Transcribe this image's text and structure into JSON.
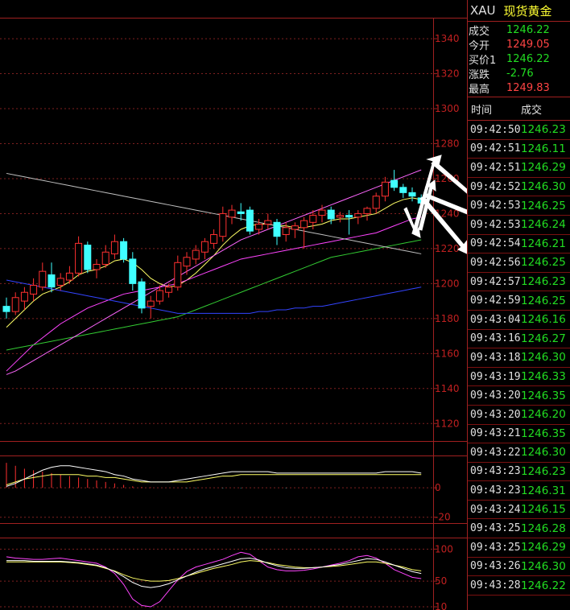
{
  "quote": {
    "symbol": "XAU",
    "name": "现货黄金",
    "fields": [
      {
        "label": "成交",
        "value": "1246.22",
        "color": "#22dd22"
      },
      {
        "label": "今开",
        "value": "1249.05",
        "color": "#ff4444"
      },
      {
        "label": "买价1",
        "value": "1246.22",
        "color": "#22dd22"
      },
      {
        "label": "涨跌",
        "value": "-2.76",
        "color": "#22dd22"
      },
      {
        "label": "最高",
        "value": "1249.83",
        "color": "#ff4444"
      }
    ],
    "ticks_header": {
      "time": "时间",
      "price": "成交"
    },
    "ticks": [
      {
        "time": "09:42:50",
        "price": "1246.23"
      },
      {
        "time": "09:42:51",
        "price": "1246.11"
      },
      {
        "time": "09:42:51",
        "price": "1246.29"
      },
      {
        "time": "09:42:52",
        "price": "1246.30"
      },
      {
        "time": "09:42:53",
        "price": "1246.25"
      },
      {
        "time": "09:42:53",
        "price": "1246.24"
      },
      {
        "time": "09:42:54",
        "price": "1246.21"
      },
      {
        "time": "09:42:56",
        "price": "1246.25"
      },
      {
        "time": "09:42:57",
        "price": "1246.23"
      },
      {
        "time": "09:42:59",
        "price": "1246.25"
      },
      {
        "time": "09:43:04",
        "price": "1246.16"
      },
      {
        "time": "09:43:16",
        "price": "1246.27"
      },
      {
        "time": "09:43:18",
        "price": "1246.30"
      },
      {
        "time": "09:43:19",
        "price": "1246.33"
      },
      {
        "time": "09:43:20",
        "price": "1246.35"
      },
      {
        "time": "09:43:20",
        "price": "1246.20"
      },
      {
        "time": "09:43:21",
        "price": "1246.35"
      },
      {
        "time": "09:43:22",
        "price": "1246.30"
      },
      {
        "time": "09:43:23",
        "price": "1246.23"
      },
      {
        "time": "09:43:23",
        "price": "1246.31"
      },
      {
        "time": "09:43:24",
        "price": "1246.15"
      },
      {
        "time": "09:43:25",
        "price": "1246.28"
      },
      {
        "time": "09:43:25",
        "price": "1246.29"
      },
      {
        "time": "09:43:26",
        "price": "1246.30"
      },
      {
        "time": "09:43:28",
        "price": "1246.22"
      }
    ]
  },
  "chart_data": [
    {
      "type": "candlestick",
      "y_ticks": [
        1120,
        1140,
        1160,
        1180,
        1200,
        1220,
        1240,
        1260,
        1280,
        1300,
        1320,
        1340
      ],
      "ylim": [
        1110,
        1352
      ],
      "up_color": "#ff3030",
      "down_color": "#40ffff",
      "candles": [
        {
          "o": 1187,
          "h": 1192,
          "l": 1180,
          "c": 1184
        },
        {
          "o": 1184,
          "h": 1195,
          "l": 1182,
          "c": 1192
        },
        {
          "o": 1190,
          "h": 1198,
          "l": 1185,
          "c": 1195
        },
        {
          "o": 1194,
          "h": 1203,
          "l": 1190,
          "c": 1199
        },
        {
          "o": 1198,
          "h": 1212,
          "l": 1196,
          "c": 1207
        },
        {
          "o": 1205,
          "h": 1212,
          "l": 1195,
          "c": 1198
        },
        {
          "o": 1199,
          "h": 1206,
          "l": 1196,
          "c": 1203
        },
        {
          "o": 1202,
          "h": 1210,
          "l": 1200,
          "c": 1206
        },
        {
          "o": 1206,
          "h": 1227,
          "l": 1204,
          "c": 1223
        },
        {
          "o": 1222,
          "h": 1224,
          "l": 1206,
          "c": 1208
        },
        {
          "o": 1208,
          "h": 1214,
          "l": 1203,
          "c": 1211
        },
        {
          "o": 1211,
          "h": 1222,
          "l": 1209,
          "c": 1218
        },
        {
          "o": 1217,
          "h": 1228,
          "l": 1214,
          "c": 1224
        },
        {
          "o": 1224,
          "h": 1226,
          "l": 1212,
          "c": 1214
        },
        {
          "o": 1214,
          "h": 1218,
          "l": 1196,
          "c": 1200
        },
        {
          "o": 1201,
          "h": 1203,
          "l": 1183,
          "c": 1186
        },
        {
          "o": 1187,
          "h": 1193,
          "l": 1180,
          "c": 1190
        },
        {
          "o": 1190,
          "h": 1199,
          "l": 1188,
          "c": 1196
        },
        {
          "o": 1195,
          "h": 1200,
          "l": 1192,
          "c": 1198
        },
        {
          "o": 1198,
          "h": 1216,
          "l": 1196,
          "c": 1212
        },
        {
          "o": 1210,
          "h": 1218,
          "l": 1205,
          "c": 1215
        },
        {
          "o": 1214,
          "h": 1222,
          "l": 1211,
          "c": 1219
        },
        {
          "o": 1218,
          "h": 1226,
          "l": 1214,
          "c": 1224
        },
        {
          "o": 1223,
          "h": 1231,
          "l": 1220,
          "c": 1228
        },
        {
          "o": 1227,
          "h": 1244,
          "l": 1224,
          "c": 1240
        },
        {
          "o": 1238,
          "h": 1245,
          "l": 1234,
          "c": 1242
        },
        {
          "o": 1241,
          "h": 1246,
          "l": 1236,
          "c": 1240
        },
        {
          "o": 1242,
          "h": 1244,
          "l": 1228,
          "c": 1230
        },
        {
          "o": 1231,
          "h": 1237,
          "l": 1228,
          "c": 1234
        },
        {
          "o": 1234,
          "h": 1240,
          "l": 1231,
          "c": 1236
        },
        {
          "o": 1235,
          "h": 1237,
          "l": 1222,
          "c": 1227
        },
        {
          "o": 1228,
          "h": 1235,
          "l": 1224,
          "c": 1232
        },
        {
          "o": 1231,
          "h": 1235,
          "l": 1226,
          "c": 1233
        },
        {
          "o": 1232,
          "h": 1238,
          "l": 1220,
          "c": 1236
        },
        {
          "o": 1235,
          "h": 1242,
          "l": 1231,
          "c": 1239
        },
        {
          "o": 1239,
          "h": 1245,
          "l": 1235,
          "c": 1242
        },
        {
          "o": 1242,
          "h": 1244,
          "l": 1234,
          "c": 1237
        },
        {
          "o": 1238,
          "h": 1241,
          "l": 1235,
          "c": 1239
        },
        {
          "o": 1239,
          "h": 1242,
          "l": 1228,
          "c": 1238
        },
        {
          "o": 1238,
          "h": 1242,
          "l": 1234,
          "c": 1240
        },
        {
          "o": 1240,
          "h": 1244,
          "l": 1236,
          "c": 1243
        },
        {
          "o": 1243,
          "h": 1252,
          "l": 1240,
          "c": 1250
        },
        {
          "o": 1250,
          "h": 1261,
          "l": 1247,
          "c": 1258
        },
        {
          "o": 1259,
          "h": 1265,
          "l": 1253,
          "c": 1255
        },
        {
          "o": 1255,
          "h": 1257,
          "l": 1249,
          "c": 1252
        },
        {
          "o": 1252,
          "h": 1255,
          "l": 1247,
          "c": 1250
        },
        {
          "o": 1249,
          "h": 1251,
          "l": 1240,
          "c": 1246
        }
      ],
      "ma_lines": [
        {
          "color": "#ffff66",
          "values": [
            1175,
            1180,
            1185,
            1190,
            1194,
            1196,
            1198,
            1201,
            1205,
            1207,
            1208,
            1210,
            1213,
            1214,
            1212,
            1208,
            1203,
            1200,
            1198,
            1199,
            1202,
            1206,
            1211,
            1216,
            1222,
            1227,
            1231,
            1233,
            1234,
            1234,
            1233,
            1233,
            1232,
            1232,
            1233,
            1234,
            1236,
            1237,
            1237,
            1238,
            1239,
            1240,
            1243,
            1246,
            1248,
            1249,
            1248
          ]
        },
        {
          "color": "#ff44ff",
          "values": [
            1150,
            1155,
            1160,
            1165,
            1169,
            1173,
            1177,
            1180,
            1183,
            1186,
            1188,
            1190,
            1192,
            1194,
            1195,
            1196,
            1197,
            1198,
            1199,
            1200,
            1202,
            1204,
            1206,
            1208,
            1210,
            1212,
            1214,
            1215,
            1216,
            1217,
            1218,
            1219,
            1220,
            1221,
            1222,
            1223,
            1224,
            1225,
            1226,
            1227,
            1228,
            1229,
            1231,
            1233,
            1235,
            1237,
            1238
          ]
        },
        {
          "color": "#33cc33",
          "values": [
            1162,
            1163,
            1164,
            1165,
            1166,
            1167,
            1168,
            1169,
            1170,
            1171,
            1172,
            1173,
            1174,
            1175,
            1176,
            1177,
            1178,
            1179,
            1180,
            1181,
            1183,
            1185,
            1187,
            1189,
            1191,
            1193,
            1195,
            1197,
            1199,
            1201,
            1203,
            1205,
            1207,
            1209,
            1211,
            1213,
            1215,
            1216,
            1217,
            1218,
            1219,
            1220,
            1221,
            1222,
            1223,
            1224,
            1225
          ]
        },
        {
          "color": "#c0c0c0",
          "values": [
            1263,
            1262,
            1261,
            1260,
            1259,
            1258,
            1257,
            1256,
            1255,
            1254,
            1253,
            1252,
            1251,
            1250,
            1249,
            1248,
            1247,
            1246,
            1245,
            1244,
            1243,
            1242,
            1241,
            1240,
            1239,
            1238,
            1237,
            1236,
            1235,
            1234,
            1233,
            1232,
            1231,
            1230,
            1229,
            1228,
            1227,
            1226,
            1225,
            1224,
            1223,
            1222,
            1221,
            1220,
            1219,
            1218,
            1217
          ]
        },
        {
          "color": "#3344ff",
          "values": [
            1202,
            1201,
            1200,
            1199,
            1198,
            1197,
            1196,
            1195,
            1194,
            1193,
            1192,
            1191,
            1190,
            1189,
            1188,
            1187,
            1186,
            1185,
            1184,
            1183,
            1183,
            1183,
            1183,
            1183,
            1183,
            1183,
            1183,
            1183,
            1184,
            1184,
            1185,
            1185,
            1186,
            1186,
            1187,
            1187,
            1188,
            1189,
            1190,
            1191,
            1192,
            1193,
            1194,
            1195,
            1196,
            1197,
            1198
          ]
        },
        {
          "color": "#ff66ff",
          "values": [
            1148,
            1150,
            1153,
            1156,
            1159,
            1162,
            1165,
            1168,
            1171,
            1174,
            1177,
            1180,
            1183,
            1186,
            1189,
            1192,
            1195,
            1198,
            1201,
            1204,
            1207,
            1210,
            1213,
            1216,
            1219,
            1222,
            1225,
            1227,
            1229,
            1231,
            1233,
            1235,
            1237,
            1239,
            1241,
            1243,
            1245,
            1247,
            1249,
            1251,
            1253,
            1255,
            1257,
            1259,
            1261,
            1263,
            1265
          ]
        }
      ]
    },
    {
      "type": "bar",
      "y_ticks": [
        0,
        -20
      ],
      "ylim": [
        -24,
        22
      ],
      "values": [
        17,
        15,
        13,
        12,
        11,
        10,
        9,
        8,
        7,
        6,
        5,
        4,
        3,
        2,
        1,
        0.5,
        0.3,
        0,
        0,
        0,
        -0.3,
        -0.3,
        0,
        0,
        -0.3,
        0,
        -0.3,
        0,
        0,
        0,
        0,
        -0.3,
        0,
        0,
        0,
        0,
        0,
        0,
        0,
        0,
        0,
        0,
        0,
        0,
        0,
        0,
        0
      ],
      "lines": [
        {
          "color": "#ffff66",
          "values": [
            2,
            4,
            6,
            7,
            8,
            9,
            9,
            9,
            9,
            8,
            8,
            7,
            7,
            6,
            5,
            4,
            4,
            4,
            4,
            4,
            4,
            5,
            6,
            7,
            8,
            8,
            9,
            9,
            9,
            9,
            9,
            9,
            9,
            9,
            9,
            9,
            9,
            9,
            9,
            9,
            9,
            9,
            9,
            9,
            9,
            9,
            9
          ]
        },
        {
          "color": "#ffffff",
          "values": [
            1,
            3,
            6,
            9,
            12,
            14,
            15,
            15,
            14,
            13,
            12,
            11,
            9,
            8,
            6,
            5,
            4,
            4,
            4,
            5,
            6,
            7,
            8,
            9,
            10,
            11,
            11,
            11,
            11,
            11,
            10,
            10,
            10,
            10,
            10,
            10,
            10,
            10,
            10,
            10,
            10,
            10,
            11,
            11,
            11,
            11,
            10
          ]
        }
      ]
    },
    {
      "type": "line",
      "y_ticks": [
        100,
        50,
        10
      ],
      "ylim": [
        5,
        118
      ],
      "lines": [
        {
          "color": "#ff44ff",
          "values": [
            88,
            86,
            85,
            84,
            84,
            85,
            86,
            84,
            82,
            80,
            78,
            72,
            62,
            45,
            22,
            12,
            10,
            18,
            35,
            52,
            65,
            72,
            76,
            80,
            84,
            90,
            95,
            92,
            82,
            72,
            68,
            66,
            66,
            67,
            69,
            72,
            75,
            78,
            82,
            88,
            90,
            86,
            78,
            68,
            62,
            56,
            54
          ]
        },
        {
          "color": "#ffff66",
          "values": [
            80,
            80,
            80,
            80,
            80,
            80,
            80,
            79,
            78,
            76,
            74,
            70,
            66,
            60,
            55,
            52,
            50,
            50,
            51,
            54,
            58,
            62,
            66,
            70,
            73,
            76,
            80,
            82,
            81,
            79,
            76,
            74,
            72,
            71,
            71,
            72,
            73,
            74,
            76,
            78,
            80,
            80,
            78,
            75,
            72,
            68,
            66
          ]
        },
        {
          "color": "#ffffff",
          "values": [
            82,
            82,
            82,
            81,
            81,
            81,
            81,
            80,
            79,
            77,
            75,
            71,
            65,
            57,
            48,
            42,
            40,
            42,
            46,
            52,
            58,
            64,
            69,
            73,
            77,
            81,
            85,
            86,
            83,
            78,
            74,
            71,
            70,
            70,
            71,
            72,
            74,
            76,
            79,
            82,
            85,
            84,
            80,
            75,
            70,
            65,
            62
          ]
        }
      ]
    }
  ]
}
